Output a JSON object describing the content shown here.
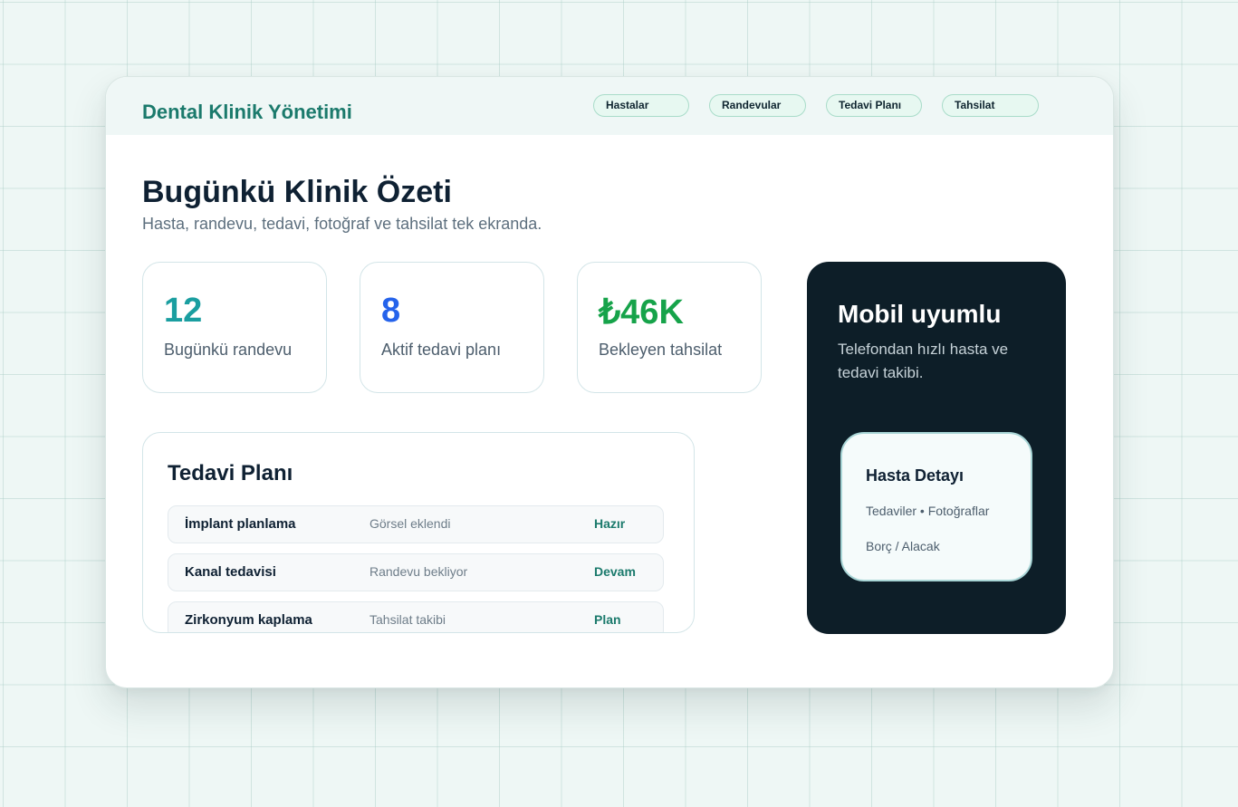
{
  "app": {
    "title": "Dental Klinik Yönetimi"
  },
  "nav": [
    {
      "label": "Hastalar"
    },
    {
      "label": "Randevular"
    },
    {
      "label": "Tedavi Planı"
    },
    {
      "label": "Tahsilat"
    }
  ],
  "summary": {
    "title": "Bugünkü Klinik Özeti",
    "subtitle": "Hasta, randevu, tedavi, fotoğraf ve tahsilat tek ekranda."
  },
  "stats": [
    {
      "value": "12",
      "label": "Bugünkü randevu",
      "color": "#1a9ea0"
    },
    {
      "value": "8",
      "label": "Aktif tedavi planı",
      "color": "#2563eb"
    },
    {
      "value": "₺46K",
      "label": "Bekleyen tahsilat",
      "color": "#16a34a"
    }
  ],
  "treatment_plan": {
    "title": "Tedavi Planı",
    "rows": [
      {
        "name": "İmplant planlama",
        "note": "Görsel eklendi",
        "status": "Hazır"
      },
      {
        "name": "Kanal tedavisi",
        "note": "Randevu bekliyor",
        "status": "Devam"
      },
      {
        "name": "Zirkonyum kaplama",
        "note": "Tahsilat takibi",
        "status": "Plan"
      }
    ]
  },
  "mobile": {
    "title": "Mobil uyumlu",
    "description": "Telefondan hızlı hasta ve tedavi takibi.",
    "detail_card": {
      "title": "Hasta Detayı",
      "line1": "Tedaviler • Fotoğraflar",
      "line2": "Borç / Alacak"
    }
  },
  "colors": {
    "brand": "#1b7a6c",
    "status_text": "#1b7a6c",
    "mobile_panel_bg": "#0d1e28",
    "nav_pill_bg": "#e7f8f1",
    "nav_pill_border": "#a9dcc9"
  }
}
